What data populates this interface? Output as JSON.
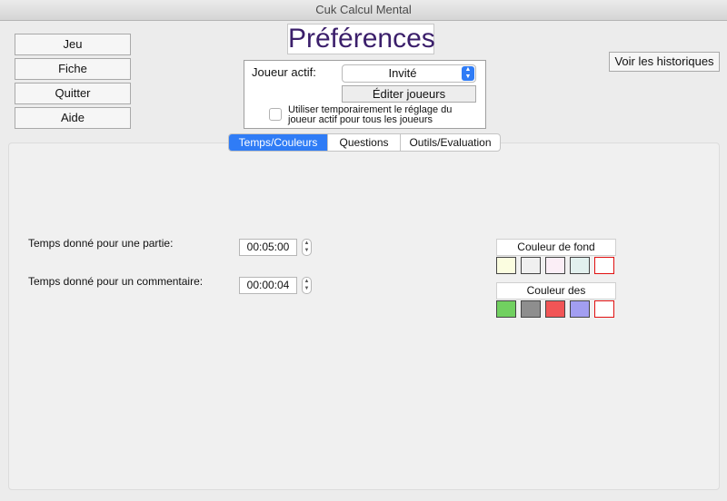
{
  "window": {
    "title": "Cuk Calcul Mental"
  },
  "nav": {
    "items": [
      {
        "label": "Jeu"
      },
      {
        "label": "Fiche"
      },
      {
        "label": "Quitter"
      },
      {
        "label": "Aide"
      }
    ]
  },
  "header": {
    "title": "Préférences",
    "history_button": "Voir les historiques"
  },
  "player": {
    "label": "Joueur actif:",
    "selected": "Invité",
    "edit_button": "Éditer joueurs",
    "temp_checkbox_label": "Utiliser temporairement le réglage du joueur actif pour tous les joueurs",
    "temp_checkbox_checked": false
  },
  "tabs": [
    {
      "label": "Temps/Couleurs",
      "active": true
    },
    {
      "label": "Questions"
    },
    {
      "label": "Outils/Evaluation"
    }
  ],
  "time": {
    "game_label": "Temps donné pour une partie:",
    "game_value": "00:05:00",
    "comment_label": "Temps donné pour un commentaire:",
    "comment_value": "00:00:04"
  },
  "colors": {
    "background_label": "Couleur de fond",
    "background_swatches": [
      "#fbfde0",
      "#f0f0f0",
      "#fbeef6",
      "#e2f0ee",
      "#ffffff"
    ],
    "text_label": "Couleur des",
    "text_swatches": [
      "#71d060",
      "#8e8e8e",
      "#f15556",
      "#a29ef1",
      "#ffffff"
    ],
    "selected_outline": "#e01010"
  }
}
